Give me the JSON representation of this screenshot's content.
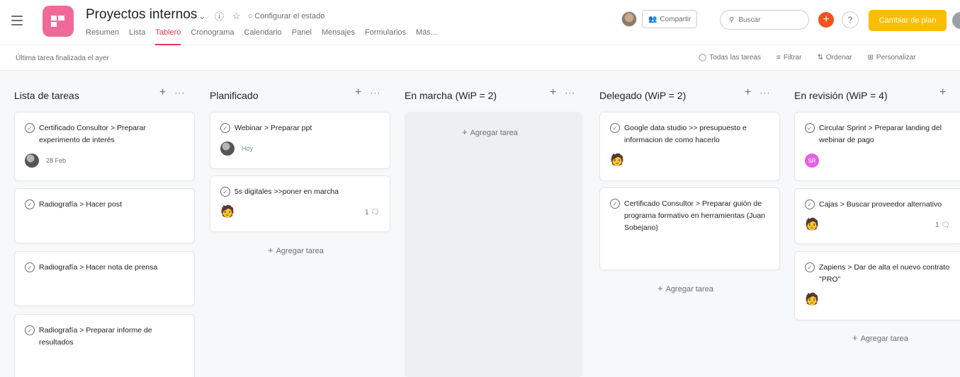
{
  "header": {
    "project_title": "Proyectos internos",
    "status_label": "Configurar el estado",
    "project_color": "#f06a99",
    "tabs": [
      {
        "label": "Resumen"
      },
      {
        "label": "Lista"
      },
      {
        "label": "Tablero",
        "active": true
      },
      {
        "label": "Cronograma"
      },
      {
        "label": "Calendario"
      },
      {
        "label": "Panel"
      },
      {
        "label": "Mensajes"
      },
      {
        "label": "Formularios"
      },
      {
        "label": "Más..."
      }
    ],
    "share_label": "Compartir",
    "search_placeholder": "Buscar",
    "upgrade_label": "Cambiar de plan",
    "upgrade_color": "#fcbd01",
    "help_label": "?"
  },
  "subheader": {
    "last_task": "Última tarea finalizada el ayer",
    "all_tasks": "Todas las tareas",
    "filter": "Filtrar",
    "sort": "Ordenar",
    "customize": "Personalizar"
  },
  "columns": [
    {
      "title": "Lista de tareas",
      "cards": [
        {
          "title": "Certificado Consultor > Preparar experimento de interés",
          "assignee": "photo",
          "due": "28 Feb"
        },
        {
          "title": "Radiografía > Hacer post"
        },
        {
          "title": "Radiografía > Hacer nota de prensa"
        },
        {
          "title": "Radiografía > Preparar informe de resultados"
        }
      ]
    },
    {
      "title": "Planificado",
      "cards": [
        {
          "title": "Webinar > Preparar ppt",
          "assignee": "photo",
          "due": "Hoy"
        },
        {
          "title": "5s digitales >>poner en marcha",
          "assignee": "figure",
          "comments": "1"
        }
      ],
      "add_task": "Agregar tarea"
    },
    {
      "title": "En marcha (WiP = 2)",
      "cards": [],
      "add_task": "Agregar tarea"
    },
    {
      "title": "Delegado (WiP = 2)",
      "cards": [
        {
          "title": "Google data studio >> presupuesto e informacion de como hacerlo",
          "assignee": "figure"
        },
        {
          "title": "Certificado Consultor > Preparar guión de programa formativo en herramientas (Juan Sobejano)"
        }
      ],
      "add_task": "Agregar tarea"
    },
    {
      "title": "En revisión (WiP = 4)",
      "cards": [
        {
          "title": "Circular Sprint > Preparar landing del webinar de pago",
          "assignee": "SR"
        },
        {
          "title": "Cajas > Buscar proveedor alternativo",
          "assignee": "figure",
          "comments": "1"
        },
        {
          "title": "Zapiens > Dar de alta el nuevo contrato \"PRO\"",
          "assignee": "figure"
        }
      ],
      "add_task": "Agregar tarea"
    }
  ]
}
